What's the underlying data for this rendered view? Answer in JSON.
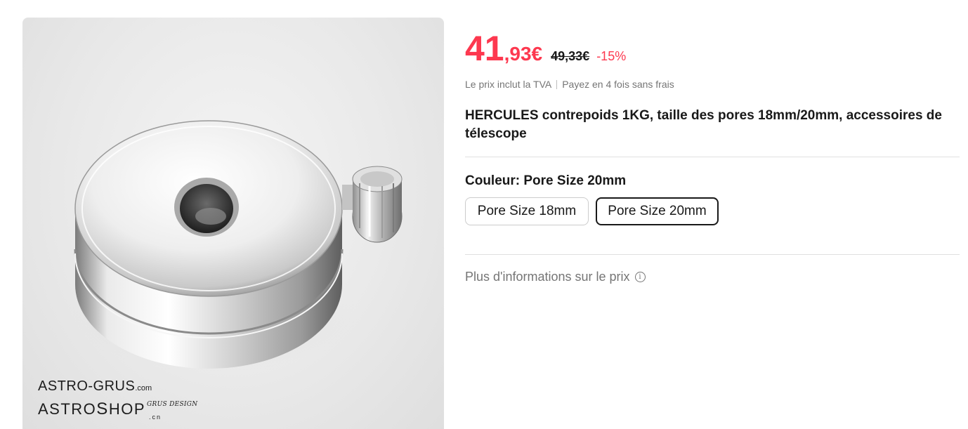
{
  "product_image": {
    "watermark_line1": "ASTRO-GRUS",
    "watermark_line1_suffix": ".com",
    "watermark_line2_a": "ASTRO",
    "watermark_line2_b": "HOP",
    "watermark_design": "GRUS DESIGN",
    "watermark_cn": ".cn"
  },
  "price": {
    "integer": "41",
    "decimal": ",93€",
    "original": "49,33€",
    "discount": "-15%",
    "accent_color": "#fd384f"
  },
  "tax": {
    "vat_text": "Le prix inclut la TVA",
    "installments_text": "Payez en 4 fois sans frais"
  },
  "product": {
    "title": "HERCULES contrepoids 1KG, taille des pores 18mm/20mm, accessoires de télescope"
  },
  "variant": {
    "label": "Couleur: Pore Size 20mm",
    "options": [
      "Pore Size 18mm",
      "Pore Size 20mm"
    ],
    "selected": "Pore Size 20mm"
  },
  "more_info": {
    "text": "Plus d'informations sur le prix",
    "icon": "info-circle-icon"
  }
}
